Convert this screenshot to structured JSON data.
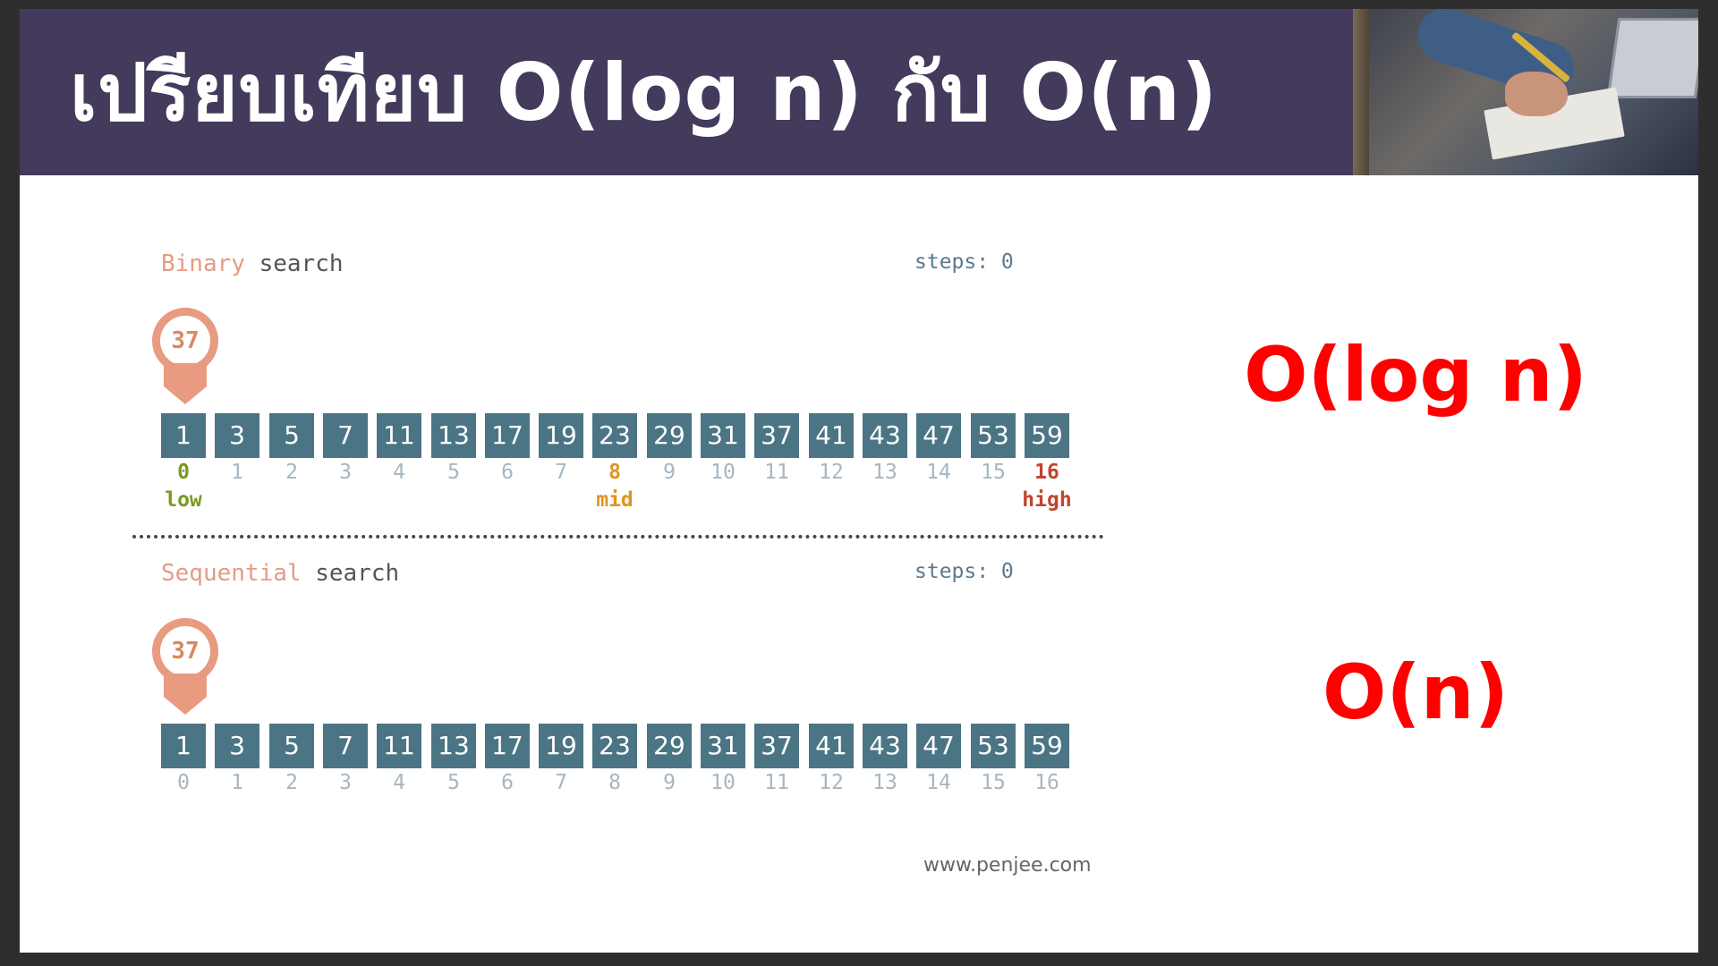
{
  "title": "เปรียบเทียบ  O(log n) กับ O(n)",
  "binary": {
    "title_accent": "Binary",
    "title_rest": " search",
    "steps_label": "steps: 0",
    "target": "37",
    "values": [
      "1",
      "3",
      "5",
      "7",
      "11",
      "13",
      "17",
      "19",
      "23",
      "29",
      "31",
      "37",
      "41",
      "43",
      "47",
      "53",
      "59"
    ],
    "indices": [
      "0",
      "1",
      "2",
      "3",
      "4",
      "5",
      "6",
      "7",
      "8",
      "9",
      "10",
      "11",
      "12",
      "13",
      "14",
      "15",
      "16"
    ],
    "low_label": "low",
    "mid_label": "mid",
    "high_label": "high",
    "low_index": 0,
    "mid_index": 8,
    "high_index": 16
  },
  "sequential": {
    "title_accent": "Sequential",
    "title_rest": " search",
    "steps_label": "steps: 0",
    "target": "37",
    "values": [
      "1",
      "3",
      "5",
      "7",
      "11",
      "13",
      "17",
      "19",
      "23",
      "29",
      "31",
      "37",
      "41",
      "43",
      "47",
      "53",
      "59"
    ],
    "indices": [
      "0",
      "1",
      "2",
      "3",
      "4",
      "5",
      "6",
      "7",
      "8",
      "9",
      "10",
      "11",
      "12",
      "13",
      "14",
      "15",
      "16"
    ]
  },
  "credit": "www.penjee.com",
  "complexity_binary": "O(log n)",
  "complexity_sequential": "O(n)",
  "colors": {
    "title_bar": "#433a5c",
    "cell": "#4b7585",
    "accent": "#e59b83",
    "complexity": "#ff0000"
  }
}
